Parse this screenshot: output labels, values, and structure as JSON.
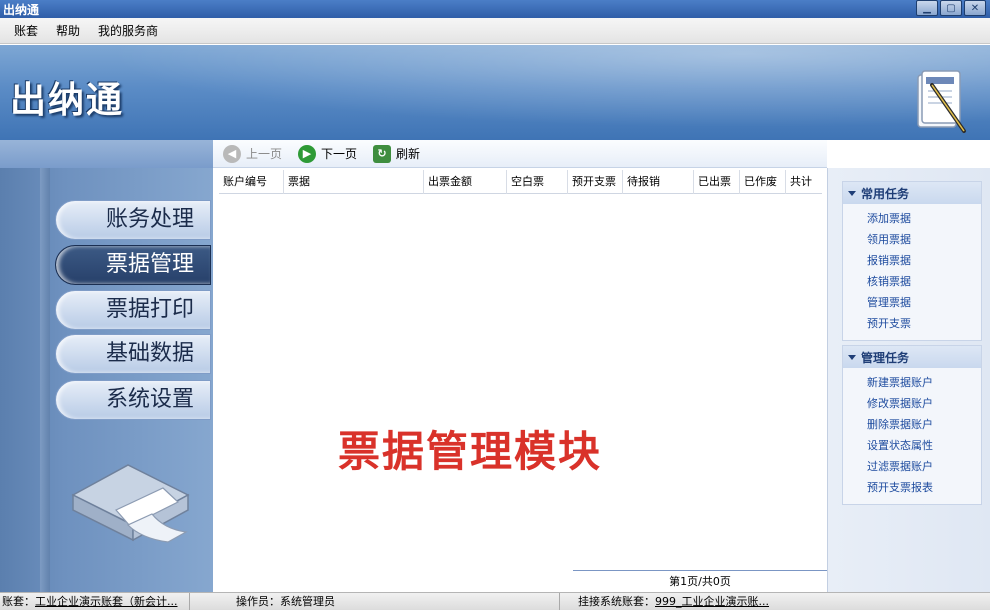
{
  "window": {
    "title": "出纳通"
  },
  "menu": [
    "账套",
    "帮助",
    "我的服务商"
  ],
  "banner": {
    "logo_text": "出纳通"
  },
  "nav": [
    {
      "label": "账务处理",
      "active": false
    },
    {
      "label": "票据管理",
      "active": true
    },
    {
      "label": "票据打印",
      "active": false
    },
    {
      "label": "基础数据",
      "active": false
    },
    {
      "label": "系统设置",
      "active": false
    }
  ],
  "toolbar": {
    "prev": "上一页",
    "next": "下一页",
    "refresh": "刷新"
  },
  "table": {
    "columns": [
      "账户编号",
      "票据",
      "出票金额",
      "空白票",
      "预开支票",
      "待报销",
      "已出票",
      "已作废",
      "共计"
    ],
    "rows": []
  },
  "module_label": "票据管理模块",
  "pager": "第1页/共0页",
  "tasks": {
    "common": {
      "title": "常用任务",
      "items": [
        "添加票据",
        "领用票据",
        "报销票据",
        "核销票据",
        "管理票据",
        "预开支票"
      ]
    },
    "manage": {
      "title": "管理任务",
      "items": [
        "新建票据账户",
        "修改票据账户",
        "删除票据账户",
        "设置状态属性",
        "过滤票据账户",
        "预开支票报表"
      ]
    }
  },
  "status": {
    "account_label": "账套：",
    "account_value": "工业企业演示账套（新会计...",
    "operator": "操作员：系统管理员",
    "linked_label": "挂接系统账套：",
    "linked_value": "999_工业企业演示账..."
  },
  "colors": {
    "accent": "#3f74b5",
    "module_label": "#d9322a",
    "link": "#1c4a9e"
  }
}
